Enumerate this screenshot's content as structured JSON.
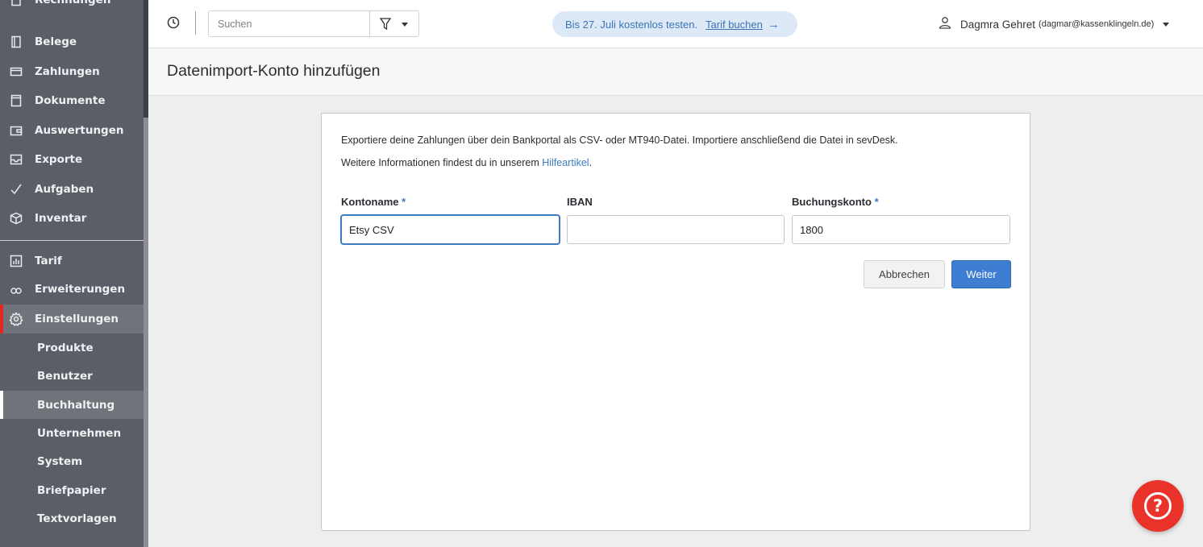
{
  "colors": {
    "sidebar_bg": "#5a5e66",
    "accent_red": "#e5261f",
    "primary_blue": "#3d7ed2",
    "link_blue": "#3c7ac3",
    "help_red": "#e8322a"
  },
  "sidebar": {
    "top_partial": "Rechnungen",
    "items": [
      {
        "label": "Belege",
        "icon": "receipt-icon"
      },
      {
        "label": "Zahlungen",
        "icon": "credit-card-icon"
      },
      {
        "label": "Dokumente",
        "icon": "document-icon"
      },
      {
        "label": "Auswertungen",
        "icon": "wallet-icon"
      },
      {
        "label": "Exporte",
        "icon": "export-tray-icon"
      },
      {
        "label": "Aufgaben",
        "icon": "checkmark-icon"
      },
      {
        "label": "Inventar",
        "icon": "box-icon"
      }
    ],
    "items2": [
      {
        "label": "Tarif",
        "icon": "bar-chart-icon"
      },
      {
        "label": "Erweiterungen",
        "icon": "plugin-icon"
      },
      {
        "label": "Einstellungen",
        "icon": "gear-icon",
        "active": true
      }
    ],
    "sub_items": [
      {
        "label": "Produkte"
      },
      {
        "label": "Benutzer"
      },
      {
        "label": "Buchhaltung",
        "active": true
      },
      {
        "label": "Unternehmen"
      },
      {
        "label": "System"
      },
      {
        "label": "Briefpapier"
      },
      {
        "label": "Textvorlagen"
      }
    ]
  },
  "topbar": {
    "search_placeholder": "Suchen",
    "trial_text": "Bis 27. Juli kostenlos testen.",
    "trial_link": "Tarif buchen",
    "trial_arrow": "→",
    "user_name": "Dagmra Gehret",
    "user_email": "(dagmar@kassenklingeln.de)"
  },
  "page": {
    "title": "Datenimport-Konto hinzufügen"
  },
  "form": {
    "intro": "Exportiere deine Zahlungen über dein Bankportal als CSV- oder MT940-Datei. Importiere anschließend die Datei in sevDesk.",
    "info_prefix": "Weitere Informationen findest du in unserem ",
    "info_link": "Hilfeartikel",
    "info_suffix": ".",
    "kontoname_label": "Kontoname",
    "kontoname_value": "Etsy CSV",
    "iban_label": "IBAN",
    "iban_value": "",
    "buchungskonto_label": "Buchungskonto",
    "buchungskonto_value": "1800",
    "required_mark": "*",
    "cancel_label": "Abbrechen",
    "next_label": "Weiter"
  },
  "help": {
    "symbol": "?"
  }
}
